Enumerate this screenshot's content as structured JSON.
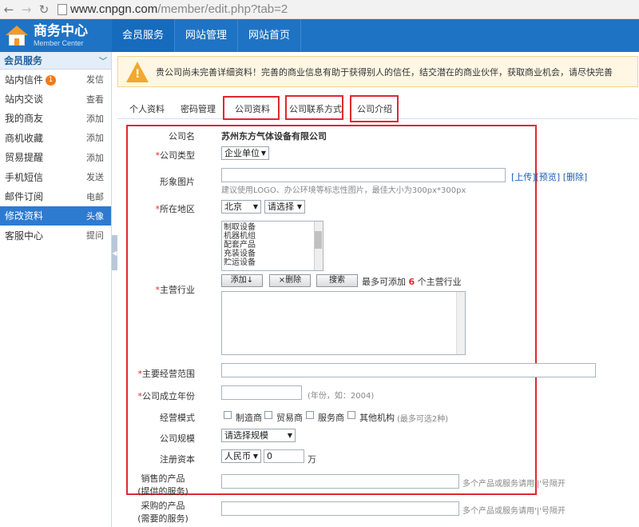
{
  "browser": {
    "url_host": "www.cnpgn.com",
    "url_path": "/member/edit.php?tab=2"
  },
  "header": {
    "title": "商务中心",
    "subtitle": "Member Center",
    "nav": [
      "会员服务",
      "网站管理",
      "网站首页"
    ]
  },
  "sidebar": {
    "title": "会员服务",
    "items": [
      {
        "label": "站内信件",
        "badge": "1",
        "action": "发信"
      },
      {
        "label": "站内交谈",
        "action": "查看"
      },
      {
        "label": "我的商友",
        "action": "添加"
      },
      {
        "label": "商机收藏",
        "action": "添加"
      },
      {
        "label": "贸易提醒",
        "action": "添加"
      },
      {
        "label": "手机短信",
        "action": "发送"
      },
      {
        "label": "邮件订阅",
        "action": "电邮"
      },
      {
        "label": "修改资料",
        "action": "头像"
      },
      {
        "label": "客服中心",
        "action": "提问"
      }
    ]
  },
  "notice": "贵公司尚未完善详细资料！完善的商业信息有助于获得别人的信任，结交潜在的商业伙伴，获取商业机会，请尽快完善",
  "tabs": [
    "个人资料",
    "密码管理",
    "公司资料",
    "公司联系方式",
    "公司介绍"
  ],
  "form": {
    "company_name_label": "公司名",
    "company_name": "苏州东方气体设备有限公司",
    "company_type_label": "公司类型",
    "company_type": "企业单位",
    "image_label": "形象图片",
    "image_upload": "[上传]",
    "image_preview": "[预览]",
    "image_delete": "[删除]",
    "image_hint": "建议使用LOGO、办公环境等标志性图片，最佳大小为300px*300px",
    "region_label": "所在地区",
    "region_province": "北京",
    "region_city": "请选择",
    "industry_label": "主营行业",
    "industry_options": [
      "制取设备",
      "机器机组",
      "配套产品",
      "充装设备",
      "贮运设备"
    ],
    "add_button": "添加↓",
    "remove_button": "×删除",
    "search_button": "搜索",
    "industry_limit_prefix": "最多可添加",
    "industry_limit_num": "6",
    "industry_limit_suffix": "个主营行业",
    "scope_label": "主要经营范围",
    "year_label": "公司成立年份",
    "year_hint": "(年份，如：2004)",
    "mode_label": "经营模式",
    "modes": [
      "制造商",
      "贸易商",
      "服务商",
      "其他机构"
    ],
    "mode_hint": "(最多可选2种)",
    "scale_label": "公司规模",
    "scale_value": "请选择规模",
    "capital_label": "注册资本",
    "capital_currency": "人民币",
    "capital_value": "0",
    "capital_unit": "万",
    "sell_label_1": "销售的产品",
    "sell_label_2": "(提供的服务)",
    "sell_hint": "多个产品或服务请用'|'号隔开",
    "buy_label_1": "采购的产品",
    "buy_label_2": "(需要的服务)",
    "buy_hint": "多个产品或服务请用'|'号隔开"
  },
  "colors": {
    "header_blue": "#1f73c4",
    "highlight_red": "#e0282e",
    "warn_orange": "#f3a82e"
  }
}
